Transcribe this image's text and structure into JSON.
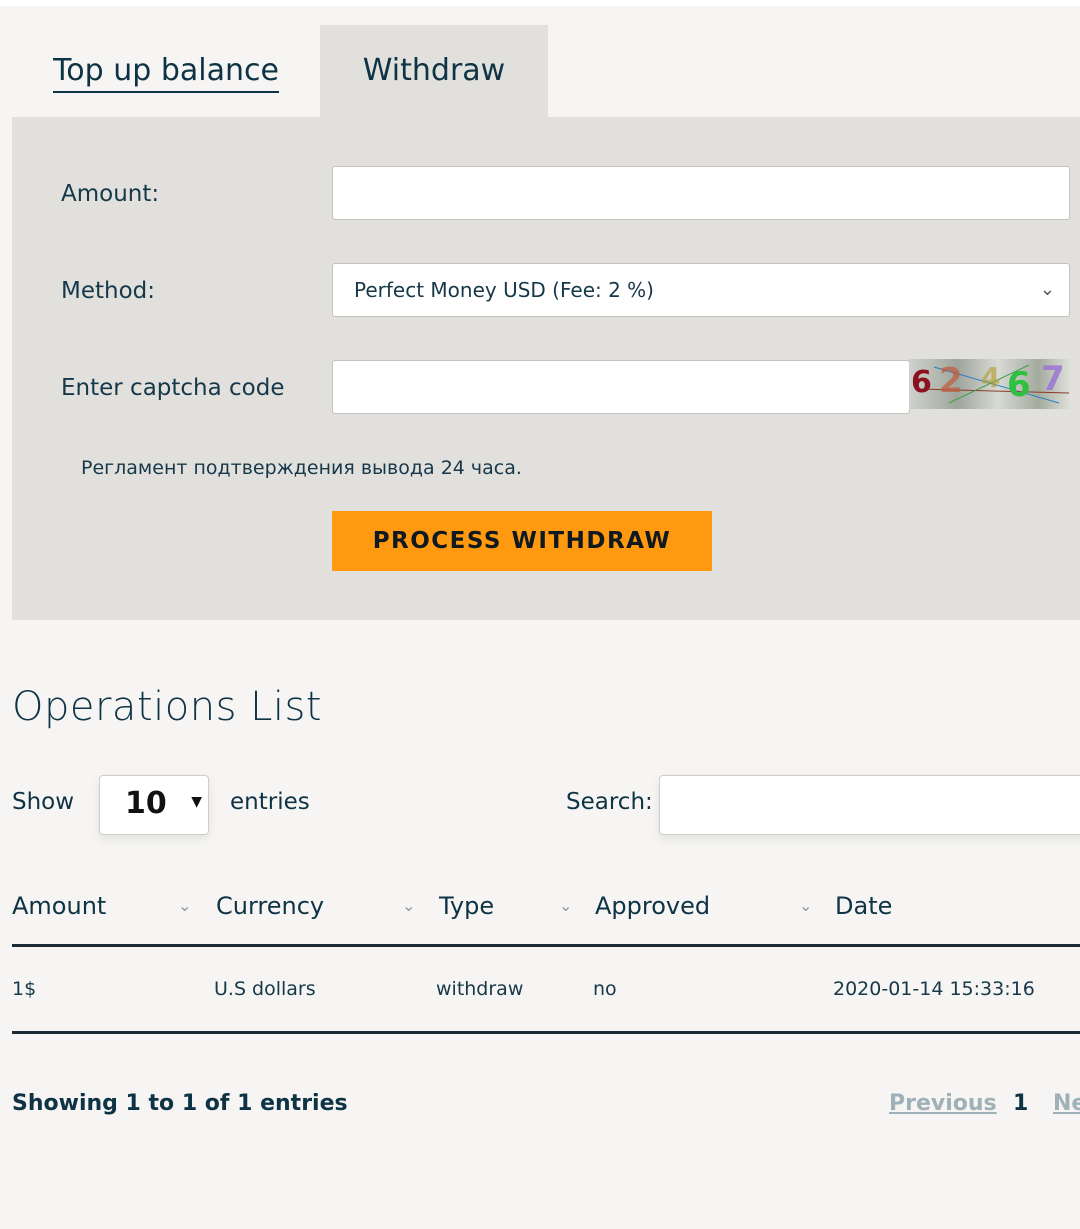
{
  "tabs": {
    "topup_label": "Top up balance",
    "withdraw_label": "Withdraw"
  },
  "form": {
    "amount_label": "Amount:",
    "amount_value": "",
    "method_label": "Method:",
    "method_value": "Perfect Money USD (Fee: 2 %)",
    "captcha_label": "Enter captcha code",
    "captcha_value": "",
    "captcha_chars": [
      "6",
      "2",
      "4",
      "6",
      "7"
    ],
    "note": "Регламент подтверждения вывода 24 часа.",
    "submit_label": "PROCESS WITHDRAW",
    "submit_color": "#ff9a10"
  },
  "operations": {
    "title": "Operations List",
    "show_label": "Show",
    "page_length": "10",
    "entries_label": "entries",
    "search_label": "Search:",
    "search_value": "",
    "columns": [
      "Amount",
      "Currency",
      "Type",
      "Approved",
      "Date"
    ],
    "rows": [
      [
        "1$",
        "U.S dollars",
        "withdraw",
        "no",
        "2020-01-14 15:33:16"
      ]
    ],
    "info": "Showing 1 to 1 of 1 entries",
    "pagination": {
      "previous": "Previous",
      "current": "1",
      "next": "Ne"
    }
  }
}
